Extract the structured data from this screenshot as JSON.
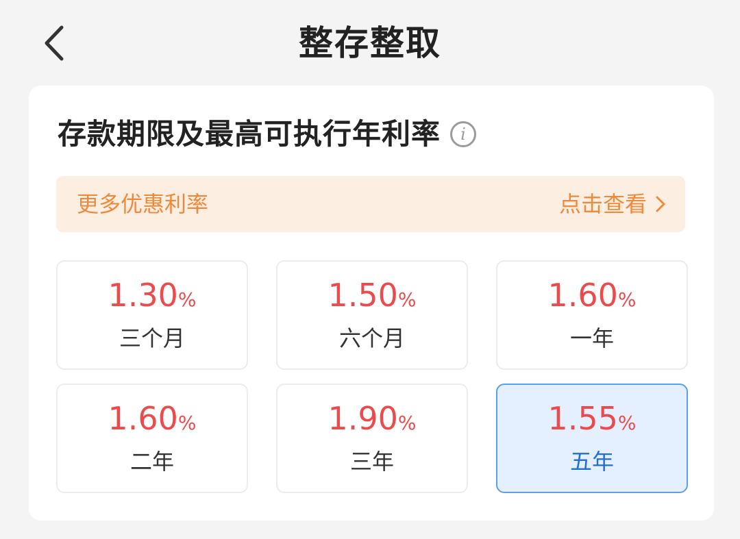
{
  "header": {
    "title": "整存整取",
    "back_icon": "chevron-left-icon"
  },
  "card": {
    "section_title": "存款期限及最高可执行年利率",
    "info_icon": "i",
    "promo": {
      "label": "更多优惠利率",
      "link_text": "点击查看"
    }
  },
  "rates": [
    {
      "value": "1.30",
      "unit": "%",
      "term": "三个月",
      "selected": false
    },
    {
      "value": "1.50",
      "unit": "%",
      "term": "六个月",
      "selected": false
    },
    {
      "value": "1.60",
      "unit": "%",
      "term": "一年",
      "selected": false
    },
    {
      "value": "1.60",
      "unit": "%",
      "term": "二年",
      "selected": false
    },
    {
      "value": "1.90",
      "unit": "%",
      "term": "三年",
      "selected": false
    },
    {
      "value": "1.55",
      "unit": "%",
      "term": "五年",
      "selected": true
    }
  ],
  "colors": {
    "rate_red": "#ec4b4b",
    "promo_orange": "#ee8a3c",
    "promo_bg": "#fdeee2",
    "selected_bg": "#e4efff",
    "selected_border": "#5b9ef0",
    "selected_text": "#1f6fd6"
  }
}
